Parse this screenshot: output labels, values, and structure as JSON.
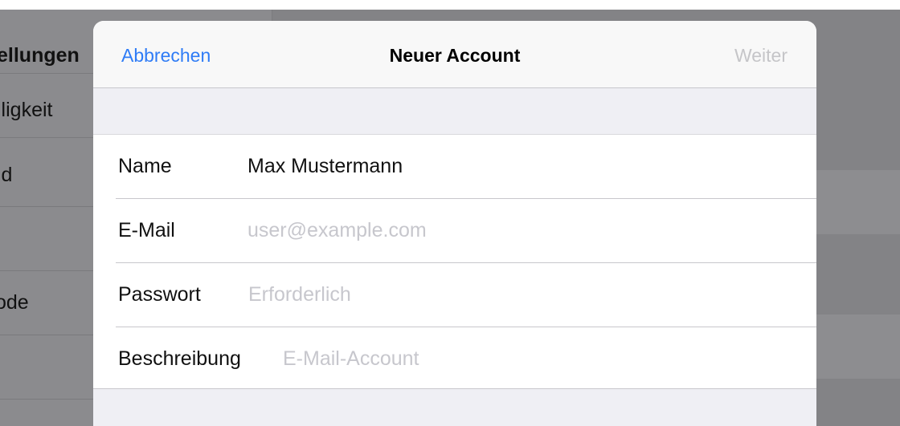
{
  "background": {
    "sidebar_items": [
      {
        "label": "ellungen"
      },
      {
        "label": "lligkeit"
      },
      {
        "label": "ld"
      },
      {
        "label": ""
      },
      {
        "label": "ode"
      },
      {
        "label": ""
      }
    ]
  },
  "sheet": {
    "cancel_label": "Abbrechen",
    "title": "Neuer Account",
    "next_label": "Weiter"
  },
  "form": {
    "fields": [
      {
        "label": "Name",
        "value": "Max Mustermann",
        "placeholder": ""
      },
      {
        "label": "E-Mail",
        "value": "",
        "placeholder": "user@example.com"
      },
      {
        "label": "Passwort",
        "value": "",
        "placeholder": "Erforderlich"
      },
      {
        "label": "Beschreibung",
        "value": "",
        "placeholder": "E-Mail-Account"
      }
    ]
  },
  "colors": {
    "accent": "#2f7cf6",
    "disabled": "#c5c5c8",
    "placeholder": "#c7c7cd",
    "overlay": "#8a8a8d"
  }
}
